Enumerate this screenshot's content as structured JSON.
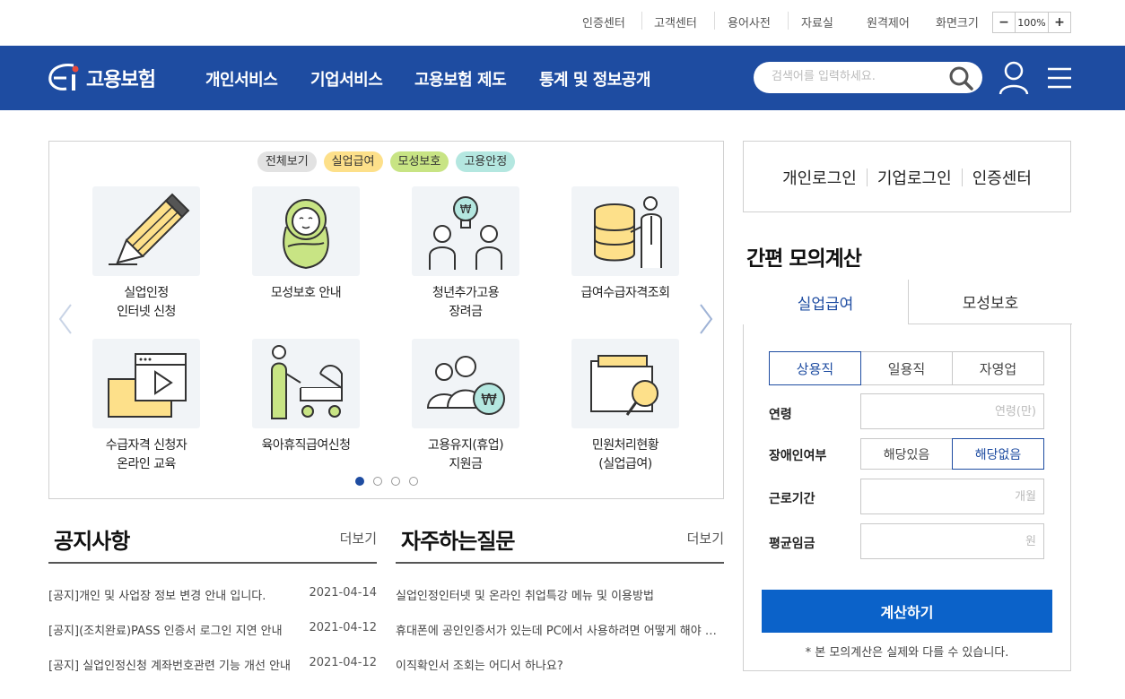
{
  "util": {
    "links": [
      "인증센터",
      "고객센터",
      "용어사전",
      "자료실",
      "원격제어"
    ],
    "zoom_label": "화면크기",
    "zoom_minus": "−",
    "zoom_value": "100%",
    "zoom_plus": "+"
  },
  "header": {
    "logo_text": "고용보험",
    "menu": [
      "개인서비스",
      "기업서비스",
      "고용보험 제도",
      "통계 및 정보공개"
    ],
    "search_placeholder": "검색어를 입력하세요."
  },
  "services": {
    "filters": [
      "전체보기",
      "실업급여",
      "모성보호",
      "고용안정"
    ],
    "filter_colors": [
      "#e2e2e2",
      "#fde08a",
      "#c8e484",
      "#b4e7e0"
    ],
    "tiles": [
      {
        "line1": "실업인정",
        "line2": "인터넷 신청",
        "icon": "pencil-icon"
      },
      {
        "line1": "모성보호 안내",
        "line2": "",
        "icon": "baby-icon"
      },
      {
        "line1": "청년추가고용",
        "line2": "장려금",
        "icon": "youth-employment-icon"
      },
      {
        "line1": "급여수급자격조회",
        "line2": "",
        "icon": "database-icon"
      },
      {
        "line1": "수급자격 신청자",
        "line2": "온라인 교육",
        "icon": "video-folder-icon"
      },
      {
        "line1": "육아휴직급여신청",
        "line2": "",
        "icon": "stroller-icon"
      },
      {
        "line1": "고용유지(휴업)",
        "line2": "지원금",
        "icon": "employment-support-icon"
      },
      {
        "line1": "민원처리현황",
        "line2": "(실업급여)",
        "icon": "folder-search-icon"
      }
    ],
    "page_count": 4,
    "current_page": 1
  },
  "notice": {
    "title": "공지사항",
    "more": "더보기",
    "items": [
      {
        "title": "[공지]개인 및 사업장 정보 변경 안내 입니다.",
        "date": "2021-04-14"
      },
      {
        "title": "[공지](조치완료)PASS 인증서 로그인 지연 안내",
        "date": "2021-04-12"
      },
      {
        "title": "[공지] 실업인정신청 계좌번호관련 기능 개선 안내",
        "date": "2021-04-12"
      }
    ]
  },
  "faq": {
    "title": "자주하는질문",
    "more": "더보기",
    "items": [
      "실업인정인터넷 및 온라인 취업특강 메뉴 및 이용방법",
      "휴대폰에 공인인증서가 있는데 PC에서 사용하려면 어떻게 해야 하나요?",
      "이직확인서 조회는 어디서 하나요?"
    ]
  },
  "login": {
    "links": [
      "개인로그인",
      "기업로그인",
      "인증센터"
    ]
  },
  "calc": {
    "title": "간편 모의계산",
    "tabs": [
      "실업급여",
      "모성보호"
    ],
    "active_tab": 0,
    "job_types": [
      "상용직",
      "일용직",
      "자영업"
    ],
    "active_job": 0,
    "age_label": "연령",
    "age_placeholder": "연령(만)",
    "disability_label": "장애인여부",
    "disability_options": [
      "해당있음",
      "해당없음"
    ],
    "active_disability": 1,
    "period_label": "근로기간",
    "period_placeholder": "개월",
    "wage_label": "평균임금",
    "wage_placeholder": "원",
    "button": "계산하기",
    "note": "* 본 모의계산은 실제와 다를 수 있습니다."
  },
  "colors": {
    "brand": "#1e4ca1",
    "button": "#0b62c9"
  }
}
